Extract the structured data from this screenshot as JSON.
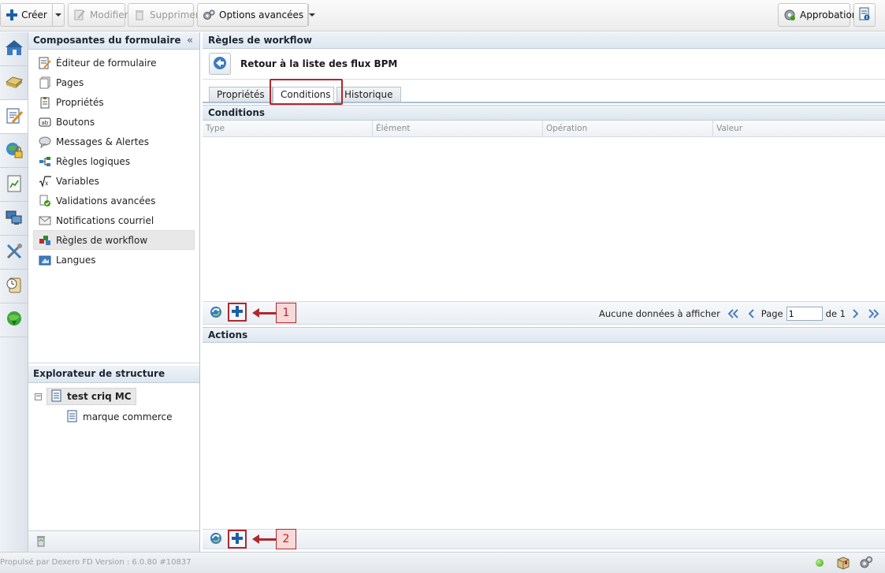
{
  "toolbar": {
    "create_label": "Créer",
    "modify_label": "Modifier",
    "delete_label": "Supprimer",
    "advanced_label": "Options avancées",
    "approval_label": "Approbation"
  },
  "rail": {
    "icons": [
      "home-icon",
      "drive-icon",
      "form-edit-icon",
      "globe-lock-icon",
      "chart-document-icon",
      "computers-icon",
      "tools-icon",
      "scroll-clock-icon",
      "globe-down-icon"
    ],
    "active_index": 2
  },
  "left_panel": {
    "title": "Composantes du formulaire",
    "collapse_glyph": "«",
    "items": [
      {
        "label": "Éditeur de formulaire",
        "icon": "form-editor-icon"
      },
      {
        "label": "Pages",
        "icon": "pages-icon"
      },
      {
        "label": "Propriétés",
        "icon": "properties-icon"
      },
      {
        "label": "Boutons",
        "icon": "buttons-icon"
      },
      {
        "label": "Messages & Alertes",
        "icon": "messages-icon"
      },
      {
        "label": "Règles logiques",
        "icon": "logic-rules-icon"
      },
      {
        "label": "Variables",
        "icon": "variables-icon"
      },
      {
        "label": "Validations avancées",
        "icon": "validations-icon"
      },
      {
        "label": "Notifications courriel",
        "icon": "email-icon"
      },
      {
        "label": "Règles de workflow",
        "icon": "workflow-icon"
      },
      {
        "label": "Langues",
        "icon": "languages-icon"
      }
    ],
    "selected_index": 9,
    "structure_title": "Explorateur de structure",
    "tree": {
      "root": "test criq MC",
      "child": "marque commerce"
    }
  },
  "main": {
    "title": "Règles de workflow",
    "back_label": "Retour à la liste des flux BPM",
    "tabs": [
      "Propriétés",
      "Conditions",
      "Historique"
    ],
    "active_tab": 1,
    "conditions_title": "Conditions",
    "columns": [
      "Type",
      "Élément",
      "Opération",
      "Valeur"
    ],
    "pager": {
      "empty_text": "Aucune données à afficher",
      "page_label": "Page",
      "page_value": "1",
      "of_label": "de 1"
    },
    "actions_title": "Actions",
    "callouts": [
      "1",
      "2"
    ]
  },
  "status": {
    "text": "Propulsé par Dexero FD Version : 6.0.80 #10837"
  },
  "colors": {
    "highlight": "#b0282e",
    "accent": "#1a5fa8"
  }
}
